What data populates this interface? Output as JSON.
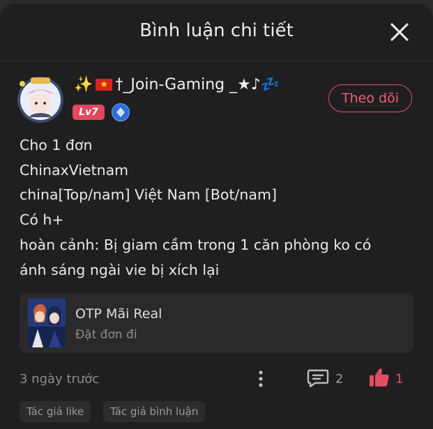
{
  "header": {
    "title": "Bình luận chi tiết"
  },
  "comment": {
    "username": "†_Join-Gaming _★♪💤",
    "level": "Lv7",
    "follow_label": "Theo dõi",
    "lines": [
      "Cho 1 đơn",
      "ChinaxVietnam",
      "china[Top/nam] Việt Nam [Bot/nam]",
      "Có h+",
      "hoàn cảnh: Bị giam cầm trong 1 căn phòng ko có",
      "ánh sáng ngài vie bị xích lại"
    ],
    "time": "3 ngày trước",
    "comment_count": "2",
    "like_count": "1"
  },
  "work_card": {
    "title": "OTP Mãi Real",
    "subtitle": "Đặt đơn đi"
  },
  "tags": [
    "Tác giả like",
    "Tác giả bình luận"
  ],
  "colors": {
    "accent": "#e55468",
    "background": "#1f1f21",
    "card": "#2a2a2c"
  }
}
